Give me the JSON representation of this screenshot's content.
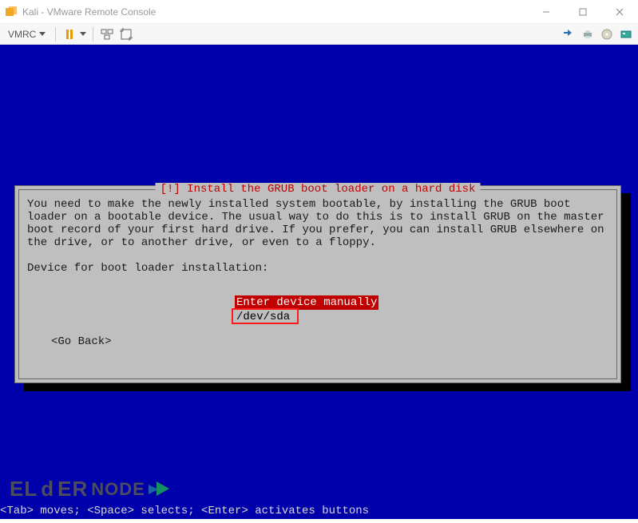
{
  "window": {
    "title": "Kali - VMware Remote Console"
  },
  "toolbar": {
    "menu_label": "VMRC"
  },
  "installer": {
    "title": "[!] Install the GRUB boot loader on a hard disk",
    "body": "You need to make the newly installed system bootable, by installing the GRUB boot loader on a bootable device. The usual way to do this is to install GRUB on the master boot record of your first hard drive. If you prefer, you can install GRUB elsewhere on the drive, or to another drive, or even to a floppy.",
    "prompt": "Device for boot loader installation:",
    "options": [
      {
        "label": "Enter device manually",
        "selected": true
      },
      {
        "label": "/dev/sda",
        "selected": false
      }
    ],
    "go_back": "<Go Back>"
  },
  "footer": {
    "help": "<Tab> moves; <Space> selects; <Enter> activates buttons"
  },
  "watermark": {
    "brand_a": "EL",
    "brand_b": "d",
    "brand_c": "ER",
    "brand_d": "NODE"
  }
}
